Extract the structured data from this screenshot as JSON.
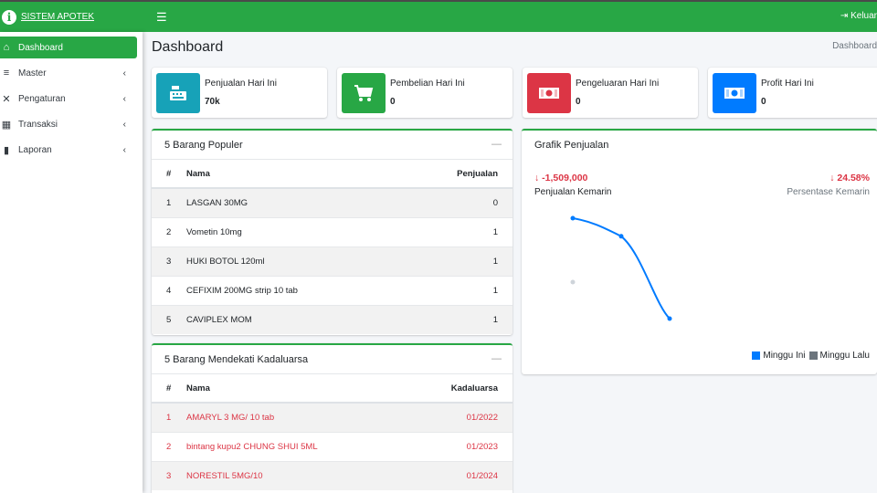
{
  "app": {
    "brand": "SISTEM APOTEK",
    "logout_label": "Keluar"
  },
  "icons": {
    "brand": "info-circle-icon",
    "menu": "hamburger-icon",
    "logout": "sign-out-icon",
    "cash_register": "cash-register-icon",
    "cart": "shopping-cart-icon",
    "money": "money-bill-icon"
  },
  "colors": {
    "primary": "#28a745",
    "info": "#17a2b8",
    "danger": "#dc3545",
    "blue": "#007bff",
    "gray": "#6c757d"
  },
  "sidebar": {
    "items": [
      {
        "label": "Dashboard",
        "icon": "home-icon",
        "active": true
      },
      {
        "label": "Master",
        "icon": "database-icon",
        "active": false
      },
      {
        "label": "Pengaturan",
        "icon": "tools-icon",
        "active": false
      },
      {
        "label": "Transaksi",
        "icon": "cash-register-icon",
        "active": false
      },
      {
        "label": "Laporan",
        "icon": "book-icon",
        "active": false
      }
    ]
  },
  "page": {
    "title": "Dashboard",
    "breadcrumb": "Dashboard"
  },
  "info_boxes": [
    {
      "label": "Penjualan Hari Ini",
      "value": "70k",
      "color": "#17a2b8"
    },
    {
      "label": "Pembelian Hari Ini",
      "value": "0",
      "color": "#28a745"
    },
    {
      "label": "Pengeluaran Hari Ini",
      "value": "0",
      "color": "#dc3545"
    },
    {
      "label": "Profit Hari Ini",
      "value": "0",
      "color": "#007bff"
    }
  ],
  "popular": {
    "title": "5 Barang Populer",
    "headers": [
      "#",
      "Nama",
      "Penjualan"
    ],
    "rows": [
      {
        "no": "1",
        "name": "LASGAN 30MG",
        "value": "0"
      },
      {
        "no": "2",
        "name": "Vometin 10mg",
        "value": "1"
      },
      {
        "no": "3",
        "name": "HUKI BOTOL 120ml",
        "value": "1"
      },
      {
        "no": "4",
        "name": "CEFIXIM 200MG strip 10 tab",
        "value": "1"
      },
      {
        "no": "5",
        "name": "CAVIPLEX MOM",
        "value": "1"
      }
    ]
  },
  "expiry": {
    "title": "5 Barang Mendekati Kadaluarsa",
    "headers": [
      "#",
      "Nama",
      "Kadaluarsa"
    ],
    "rows": [
      {
        "no": "1",
        "name": "AMARYL 3 MG/ 10 tab",
        "value": "01/2022"
      },
      {
        "no": "2",
        "name": "bintang kupu2 CHUNG SHUI 5ML",
        "value": "01/2023"
      },
      {
        "no": "3",
        "name": "NORESTIL 5MG/10",
        "value": "01/2024"
      }
    ]
  },
  "sales_chart": {
    "title": "Grafik Penjualan",
    "left_stat": {
      "value": "-1,509,000",
      "label": "Penjualan Kemarin"
    },
    "right_stat": {
      "value": "24.58%",
      "label": "Persentase Kemarin"
    },
    "legend": [
      {
        "name": "Minggu Ini",
        "color": "#007bff"
      },
      {
        "name": "Minggu Lalu",
        "color": "#6c757d"
      }
    ]
  },
  "chart_data": {
    "type": "line",
    "series": [
      {
        "name": "Minggu Ini",
        "values": [
          1.0,
          0.82,
          0.0
        ]
      },
      {
        "name": "Minggu Lalu",
        "values": [
          0.5
        ]
      }
    ]
  }
}
